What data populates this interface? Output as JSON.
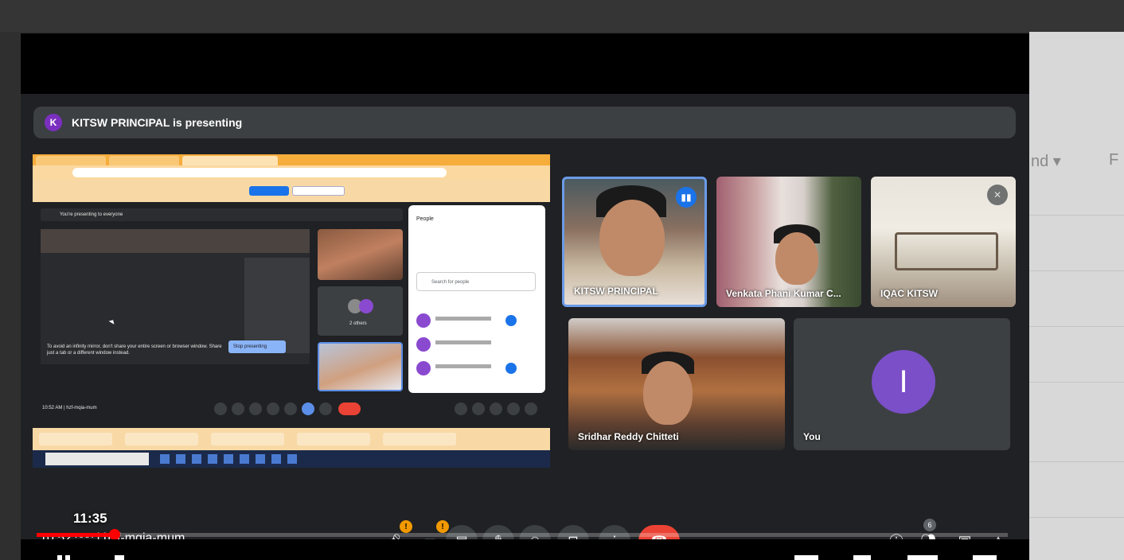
{
  "meeting": {
    "presenter_initial": "K",
    "presenting_banner": "KITSW PRINCIPAL is presenting",
    "time_and_code": "10:5? ^^^ | hzf-mqia-mum"
  },
  "participants": [
    {
      "name": "KITSW PRINCIPAL",
      "speaking": true
    },
    {
      "name": "Venkata Phani Kumar C..."
    },
    {
      "name": "IQAC KITSW",
      "muted": true
    },
    {
      "name": "Sridhar Reddy Chitteti"
    },
    {
      "name": "You",
      "initial": "I"
    }
  ],
  "controls": {
    "mic_warning": "!",
    "cam_warning": "!",
    "people_count": "6",
    "end_call_color": "#ea4335"
  },
  "youtube": {
    "hover_time": "11:35",
    "progress_fraction": 0.08,
    "progress_color": "#ff0000"
  },
  "background_page": {
    "col_label": "nd ▾",
    "col_label2": "F"
  },
  "shared_screen": {
    "presenting_notice": "You're presenting to everyone",
    "people_title": "People",
    "search_placeholder": "Search for people",
    "inner_time": "10:52 AM | hzf-mqia-mum",
    "mirror_warning": "To avoid an infinity mirror, don't share your entire screen or browser window. Share just a tab or a different window instead.",
    "stop_button": "Stop presenting",
    "others_label": "2 others"
  },
  "colors": {
    "meet_bg": "#202124",
    "tile_bg": "#3c4043",
    "speaking_border": "#6b9be8",
    "you_avatar": "#7b4fc8"
  }
}
